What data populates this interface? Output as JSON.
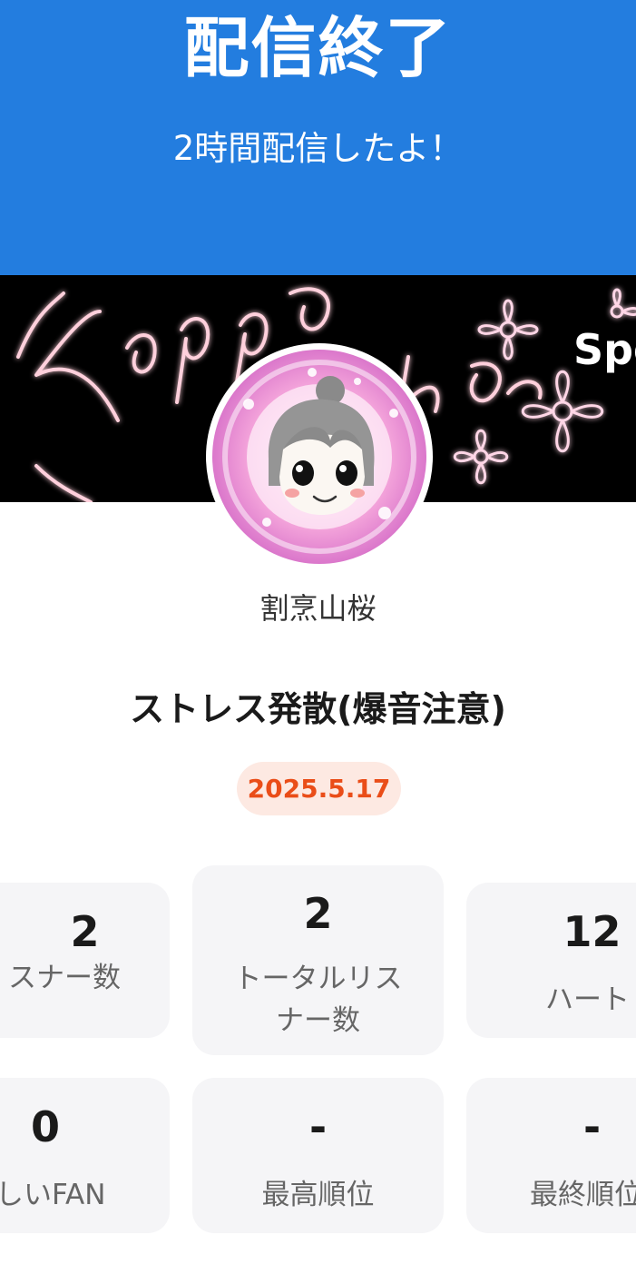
{
  "header": {
    "title": "配信終了",
    "subtitle": "2時間配信したよ！"
  },
  "banner": {
    "partial_text": "Spo"
  },
  "profile": {
    "username": "割烹山桜"
  },
  "stream": {
    "title": "ストレス発散(爆音注意)",
    "date": "2025.5.17"
  },
  "stats": [
    {
      "value": "2",
      "label": "スナー数"
    },
    {
      "value": "2",
      "label_line1": "トータルリス",
      "label_line2": "ナー数"
    },
    {
      "value": "12",
      "label": "ハート"
    },
    {
      "value": "0",
      "label": "しいFAN"
    },
    {
      "value": "-",
      "label": "最高順位"
    },
    {
      "value": "-",
      "label": "最終順位"
    }
  ],
  "colors": {
    "header_bg": "#237ddf",
    "badge_bg": "#fde9e2",
    "badge_text": "#ea4d18",
    "card_bg": "#f5f5f7"
  }
}
